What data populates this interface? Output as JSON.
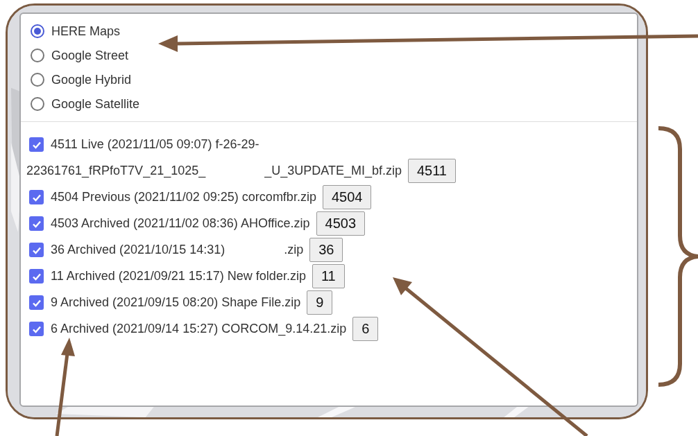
{
  "base_layers": [
    {
      "label": "HERE Maps",
      "selected": true
    },
    {
      "label": "Google Street",
      "selected": false
    },
    {
      "label": "Google Hybrid",
      "selected": false
    },
    {
      "label": "Google Satellite",
      "selected": false
    }
  ],
  "overlays": [
    {
      "checked": true,
      "lines": [
        [
          "4511 Live (2021/11/05 09:07) f-26-29-"
        ],
        [
          "22361761_fRPfoT7V_21_1025_",
          "_U_3UPDATE_MI_bf.zip"
        ]
      ],
      "button": "4511"
    },
    {
      "checked": true,
      "lines": [
        [
          "4504 Previous (2021/11/02 09:25) corcomfbr.zip"
        ]
      ],
      "button": "4504"
    },
    {
      "checked": true,
      "lines": [
        [
          "4503 Archived (2021/11/02 08:36) AHOffice.zip"
        ]
      ],
      "button": "4503"
    },
    {
      "checked": true,
      "lines": [
        [
          "36 Archived (2021/10/15 14:31)",
          ".zip"
        ]
      ],
      "button": "36"
    },
    {
      "checked": true,
      "lines": [
        [
          "11 Archived (2021/09/21 15:17) New folder.zip"
        ]
      ],
      "button": "11"
    },
    {
      "checked": true,
      "lines": [
        [
          "9 Archived (2021/09/15 08:20) Shape File.zip"
        ]
      ],
      "button": "9"
    },
    {
      "checked": true,
      "lines": [
        [
          "6 Archived (2021/09/14 15:27) CORCOM_9.14.21.zip"
        ]
      ],
      "button": "6"
    }
  ]
}
